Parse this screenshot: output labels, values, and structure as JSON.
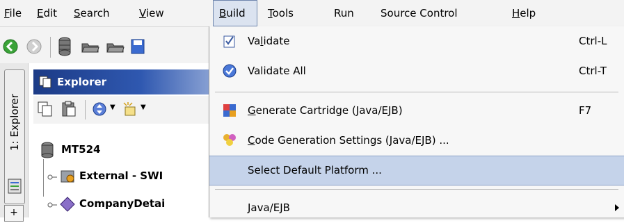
{
  "menubar": {
    "items": [
      {
        "label": "File",
        "mnemonic": "F",
        "rest": "ile"
      },
      {
        "label": "Edit",
        "mnemonic": "E",
        "rest": "dit"
      },
      {
        "label": "Search",
        "mnemonic": "S",
        "rest": "earch"
      },
      {
        "label": "View",
        "mnemonic": "V",
        "rest": "iew"
      },
      {
        "label": "Build",
        "mnemonic": "B",
        "rest": "uild"
      },
      {
        "label": "Tools",
        "mnemonic": "T",
        "rest": "ools"
      },
      {
        "label": "Run",
        "mnemonic": "",
        "rest": "Run"
      },
      {
        "label": "Source Control",
        "mnemonic": "",
        "rest": "Source Control"
      },
      {
        "label": "Help",
        "mnemonic": "H",
        "rest": "elp"
      }
    ],
    "active": "Build"
  },
  "sidebar": {
    "tab_label": "1: Explorer",
    "plus_label": "+"
  },
  "explorer": {
    "title": "Explorer",
    "tree": [
      {
        "label": "MT524",
        "icon": "database-icon"
      },
      {
        "label": "External - SWI",
        "icon": "package-icon"
      },
      {
        "label": "CompanyDetai",
        "icon": "diamond-icon"
      }
    ]
  },
  "build_menu": {
    "items": [
      {
        "pre": "Va",
        "mnemonic": "l",
        "post": "idate",
        "shortcut": "Ctrl-L",
        "icon": "validate-icon"
      },
      {
        "pre": "Validate All",
        "mnemonic": "",
        "post": "",
        "shortcut": "Ctrl-T",
        "icon": "validate-all-icon"
      },
      {
        "pre": "",
        "mnemonic": "G",
        "post": "enerate Cartridge (Java/EJB)",
        "shortcut": "F7",
        "icon": "generate-icon"
      },
      {
        "pre": "",
        "mnemonic": "C",
        "post": "ode Generation Settings (Java/EJB) ...",
        "shortcut": "",
        "icon": "settings-icon"
      },
      {
        "pre": "Select Default Platform ...",
        "mnemonic": "",
        "post": "",
        "shortcut": "",
        "icon": ""
      },
      {
        "pre": "Java/EJB",
        "mnemonic": "",
        "post": "",
        "shortcut": "",
        "icon": ""
      }
    ]
  },
  "colors": {
    "menu_bg": "#f3f3f3",
    "highlight": "#c5d3ea",
    "panel_header": "#1c3b86"
  }
}
